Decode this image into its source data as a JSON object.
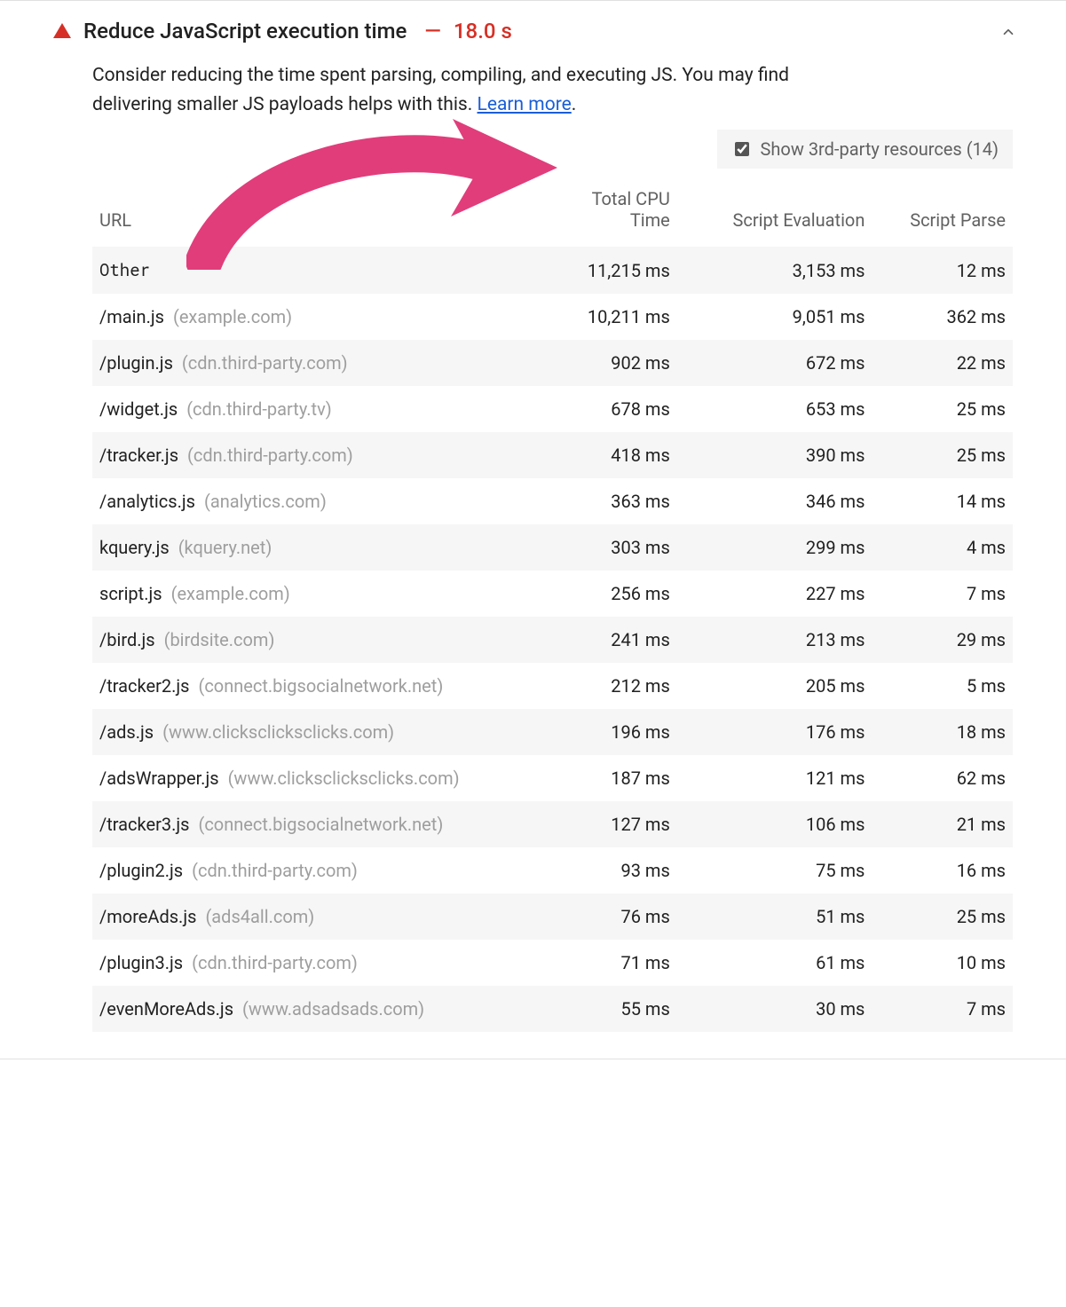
{
  "audit": {
    "title": "Reduce JavaScript execution time",
    "value": "18.0 s",
    "description_prefix": "Consider reducing the time spent parsing, compiling, and executing JS. You may find delivering smaller JS payloads helps with this. ",
    "learn_more": "Learn more",
    "description_suffix": "."
  },
  "toggle": {
    "label": "Show 3rd-party resources (14)",
    "checked": true
  },
  "columns": {
    "url": "URL",
    "cpu_line1": "Total CPU",
    "cpu_line2": "Time",
    "eval": "Script Evaluation",
    "parse": "Script Parse"
  },
  "rows": [
    {
      "path": "Other",
      "host": "",
      "mono": true,
      "cpu": "11,215 ms",
      "eval": "3,153 ms",
      "parse": "12 ms"
    },
    {
      "path": "/main.js",
      "host": "(example.com)",
      "mono": false,
      "cpu": "10,211 ms",
      "eval": "9,051 ms",
      "parse": "362 ms"
    },
    {
      "path": "/plugin.js",
      "host": "(cdn.third-party.com)",
      "mono": false,
      "cpu": "902 ms",
      "eval": "672 ms",
      "parse": "22 ms"
    },
    {
      "path": "/widget.js",
      "host": "(cdn.third-party.tv)",
      "mono": false,
      "cpu": "678 ms",
      "eval": "653 ms",
      "parse": "25 ms"
    },
    {
      "path": "/tracker.js",
      "host": "(cdn.third-party.com)",
      "mono": false,
      "cpu": "418 ms",
      "eval": "390 ms",
      "parse": "25 ms"
    },
    {
      "path": "/analytics.js",
      "host": "(analytics.com)",
      "mono": false,
      "cpu": "363 ms",
      "eval": "346 ms",
      "parse": "14 ms"
    },
    {
      "path": "kquery.js",
      "host": "(kquery.net)",
      "mono": false,
      "cpu": "303 ms",
      "eval": "299 ms",
      "parse": "4 ms"
    },
    {
      "path": "script.js",
      "host": "(example.com)",
      "mono": false,
      "cpu": "256 ms",
      "eval": "227 ms",
      "parse": "7 ms"
    },
    {
      "path": "/bird.js",
      "host": "(birdsite.com)",
      "mono": false,
      "cpu": "241 ms",
      "eval": "213 ms",
      "parse": "29 ms"
    },
    {
      "path": "/tracker2.js",
      "host": "(connect.bigsocialnetwork.net)",
      "mono": false,
      "cpu": "212 ms",
      "eval": "205 ms",
      "parse": "5 ms"
    },
    {
      "path": "/ads.js",
      "host": "(www.clicksclicksclicks.com)",
      "mono": false,
      "cpu": "196 ms",
      "eval": "176 ms",
      "parse": "18 ms"
    },
    {
      "path": "/adsWrapper.js",
      "host": "(www.clicksclicksclicks.com)",
      "mono": false,
      "cpu": "187 ms",
      "eval": "121 ms",
      "parse": "62 ms"
    },
    {
      "path": "/tracker3.js",
      "host": "(connect.bigsocialnetwork.net)",
      "mono": false,
      "cpu": "127 ms",
      "eval": "106 ms",
      "parse": "21 ms"
    },
    {
      "path": "/plugin2.js",
      "host": "(cdn.third-party.com)",
      "mono": false,
      "cpu": "93 ms",
      "eval": "75 ms",
      "parse": "16 ms"
    },
    {
      "path": "/moreAds.js",
      "host": "(ads4all.com)",
      "mono": false,
      "cpu": "76 ms",
      "eval": "51 ms",
      "parse": "25 ms"
    },
    {
      "path": "/plugin3.js",
      "host": "(cdn.third-party.com)",
      "mono": false,
      "cpu": "71 ms",
      "eval": "61 ms",
      "parse": "10 ms"
    },
    {
      "path": "/evenMoreAds.js",
      "host": "(www.adsadsads.com)",
      "mono": false,
      "cpu": "55 ms",
      "eval": "30 ms",
      "parse": "7 ms"
    }
  ]
}
